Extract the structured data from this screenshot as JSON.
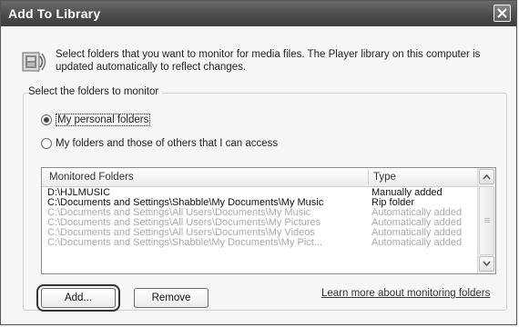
{
  "window": {
    "title": "Add To Library",
    "close_icon": "close-icon"
  },
  "header": {
    "icon": "library-media-icon",
    "description": "Select folders that you want to monitor for media files. The Player library on this computer is updated automatically to reflect changes."
  },
  "monitor_group": {
    "label": "Select the folders to monitor",
    "options": [
      {
        "label": "My personal folders",
        "checked": true
      },
      {
        "label": "My folders and those of others that I can access",
        "checked": false
      }
    ]
  },
  "folders_list": {
    "columns": [
      "Monitored Folders",
      "Type"
    ],
    "rows": [
      {
        "folder": "D:\\HJLMUSIC",
        "type": "Manually added",
        "muted": false
      },
      {
        "folder": "C:\\Documents and Settings\\Shabble\\My Documents\\My Music",
        "type": "Rip folder",
        "muted": false
      },
      {
        "folder": "C:\\Documents and Settings\\All Users\\Documents\\My Music",
        "type": "Automatically added",
        "muted": true
      },
      {
        "folder": "C:\\Documents and Settings\\All Users\\Documents\\My Pictures",
        "type": "Automatically added",
        "muted": true
      },
      {
        "folder": "C:\\Documents and Settings\\All Users\\Documents\\My Videos",
        "type": "Automatically added",
        "muted": true
      },
      {
        "folder": "C:\\Documents and Settings\\Shabble\\My Documents\\My Pict...",
        "type": "Automatically added",
        "muted": true
      }
    ]
  },
  "buttons": {
    "add": "Add...",
    "remove": "Remove"
  },
  "learn_more_link": "Learn more about monitoring folders"
}
